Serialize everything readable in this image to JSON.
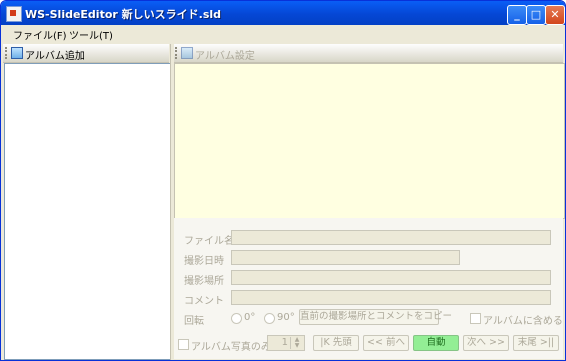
{
  "window": {
    "title": "WS-SlideEditor  新しいスライド.sld"
  },
  "menu": [
    "ファイル(F)",
    "ツール(T)"
  ],
  "toolbar_left": {
    "label": "アルバム追加"
  },
  "toolbar_right": {
    "label": "アルバム設定"
  },
  "props": {
    "filename_label": "ファイル名",
    "date_label": "撮影日時",
    "place_label": "撮影場所",
    "comment_label": "コメント",
    "rotate_label": "回転",
    "rotate_0": "0°",
    "rotate_90": "90°",
    "copy_button": "直前の撮影場所とコメントをコピー",
    "include_album": "アルバムに含める"
  },
  "nav": {
    "photos_only": "アルバム写真のみ",
    "page_value": "1",
    "first": "|K 先頭",
    "prev": "<< 前へ",
    "auto": "自動",
    "next": "次へ >>",
    "last": "末尾 >||"
  },
  "colors": {
    "title_bar": "#0a5ef6",
    "preview_bg": "#ffffe1",
    "auto_button": "#93ee95"
  }
}
